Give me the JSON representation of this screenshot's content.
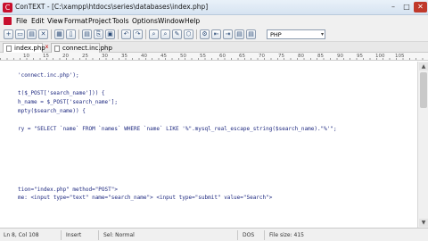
{
  "window": {
    "title": "ConTEXT - [C:\\xampp\\htdocs\\series\\databases\\index.php]",
    "min": "–",
    "max": "□",
    "close": "✕",
    "app_icon": "C"
  },
  "menu": {
    "items": [
      "File",
      "Edit",
      "View",
      "Format",
      "Project",
      "Tools",
      "Options",
      "Window",
      "Help"
    ]
  },
  "toolbar": {
    "syntax_value": "PHP",
    "syntax_arrow": "▾",
    "glyphs": [
      "+",
      "▭",
      "▤",
      "✕",
      "▦",
      "▯",
      "▤",
      "⎘",
      "▣",
      "↶",
      "↷",
      "⌕",
      "⌕",
      "✎",
      "⬡",
      "⚙",
      "⇤",
      "⇥",
      "▤",
      "▤"
    ]
  },
  "tabs": [
    {
      "label": "index.php",
      "active": true
    },
    {
      "label": "connect.inc.php",
      "active": false
    }
  ],
  "tab_close": "x",
  "ruler": {
    "ticks": [
      "10",
      "15",
      "20",
      "25",
      "30",
      "35",
      "40",
      "45",
      "50",
      "55",
      "60",
      "65",
      "70",
      "75",
      "80",
      "85",
      "90",
      "95",
      "100",
      "105"
    ]
  },
  "code": {
    "lines": [
      "",
      "'connect.inc.php');",
      "",
      "t($_POST['search_name'])) {",
      "h_name = $_POST['search_name'];",
      "mpty($search_name)) {",
      "",
      "",
      "ry = \"SELECT `name` FROM `names` WHERE `name` LIKE '%\".mysql_real_escape_string($search_name).\"%'\";",
      "",
      "",
      "",
      "",
      "",
      "",
      "",
      "",
      "tion=\"index.php\" method=\"POST\">",
      "me: <input type=\"text\" name=\"search_name\"> <input type=\"submit\" value=\"Search\">",
      ""
    ]
  },
  "scroll": {
    "up": "▲",
    "down": "▼"
  },
  "status": {
    "position": "Ln 8, Col 108",
    "mode": "Insert",
    "selection": "Sel: Normal",
    "encoding": "DOS",
    "file_size": "File size: 415"
  },
  "colors": {
    "code_text": "#1f2a80",
    "close_button": "#c0392b",
    "app_icon": "#c8102e"
  }
}
